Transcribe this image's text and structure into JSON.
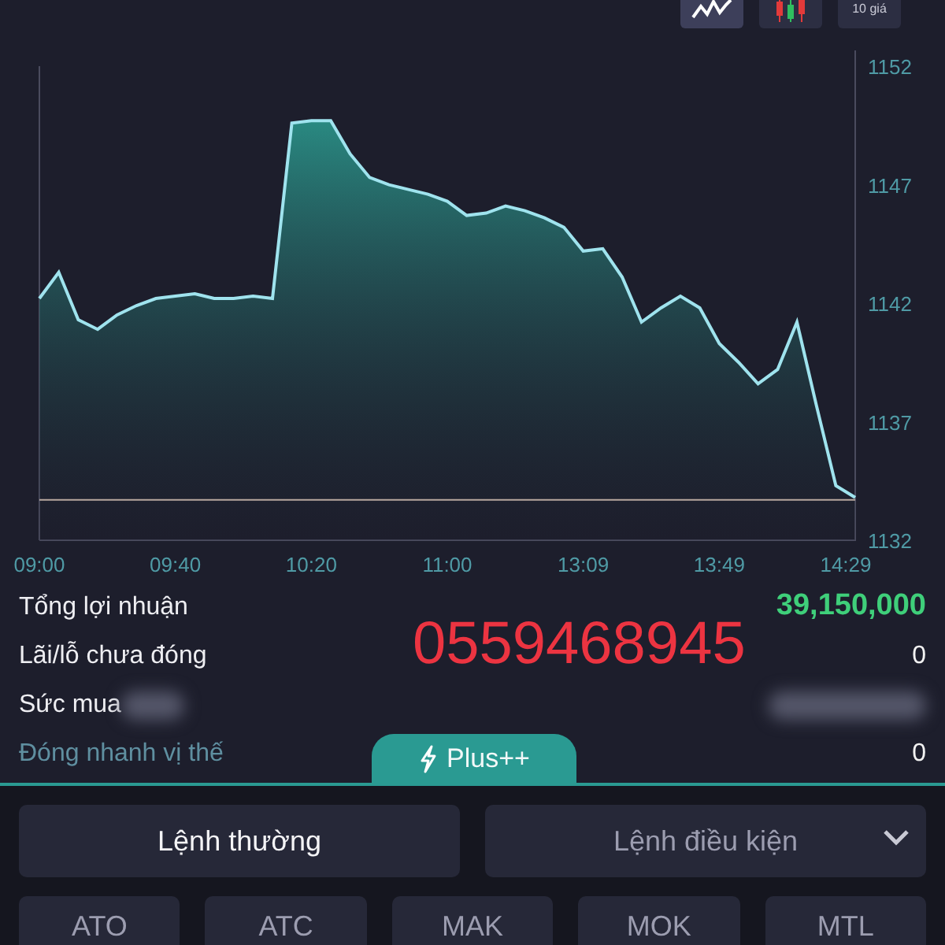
{
  "toolbar": {
    "buttons": [
      {
        "kind": "line",
        "selected": true
      },
      {
        "kind": "candle",
        "selected": false
      },
      {
        "kind": "text",
        "label": "10 giá",
        "selected": false
      }
    ]
  },
  "chart": {
    "chart_data": {
      "type": "area",
      "categories": [
        "09:00",
        null,
        null,
        null,
        null,
        null,
        null,
        "09:40",
        null,
        null,
        null,
        null,
        null,
        null,
        "10:20",
        null,
        null,
        null,
        null,
        null,
        null,
        "11:00",
        null,
        null,
        null,
        null,
        null,
        null,
        "13:09",
        null,
        null,
        null,
        null,
        null,
        null,
        "13:49",
        null,
        null,
        null,
        null,
        null,
        null,
        "14:29"
      ],
      "series": [
        {
          "color": "#9fe3ee",
          "values": [
            1142.2,
            1143.3,
            1141.3,
            1140.9,
            1141.5,
            1141.9,
            1142.2,
            1142.3,
            1142.4,
            1142.2,
            1142.2,
            1142.3,
            1142.2,
            1149.6,
            1149.7,
            1149.7,
            1148.3,
            1147.3,
            1147.0,
            1146.8,
            1146.6,
            1146.3,
            1145.7,
            1145.8,
            1146.1,
            1145.9,
            1145.6,
            1145.2,
            1144.2,
            1144.3,
            1143.1,
            1141.2,
            1141.8,
            1142.3,
            1141.8,
            1140.3,
            1139.5,
            1138.6,
            1139.2,
            1141.2,
            1137.7,
            1134.3,
            1133.8
          ]
        }
      ],
      "ylim": [
        1132,
        1152
      ],
      "yticks": [
        1132,
        1137,
        1142,
        1147,
        1152
      ],
      "ref_lines": [
        {
          "axis": "y",
          "value": 1133.7,
          "color": "#b9a9a0"
        }
      ]
    }
  },
  "summary": [
    {
      "label": "Tổng lợi nhuận",
      "kind": "profit",
      "value": "39,150,000"
    },
    {
      "label": "Lãi/lỗ chưa đóng",
      "kind": "plain",
      "value": "0"
    },
    {
      "label": "Sức mua",
      "kind": "blurred"
    },
    {
      "label": "Đóng nhanh vị thế",
      "kind": "link",
      "value": "0"
    }
  ],
  "overlay_text": "0559468945",
  "plus_tab": {
    "label": "Plus++"
  },
  "order_types": [
    {
      "label": "Lệnh thường",
      "selected": true,
      "dropdown": false
    },
    {
      "label": "Lệnh điều kiện",
      "selected": false,
      "dropdown": true
    }
  ],
  "order_buttons": [
    "ATO",
    "ATC",
    "MAK",
    "MOK",
    "MTL"
  ]
}
